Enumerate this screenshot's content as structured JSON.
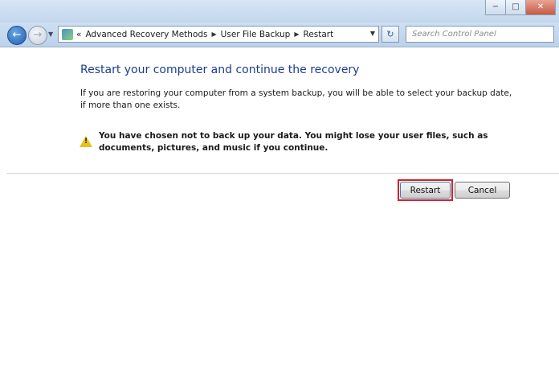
{
  "window": {
    "minimize_glyph": "−",
    "maximize_glyph": "□",
    "close_glyph": "✕"
  },
  "nav": {
    "back_glyph": "←",
    "forward_glyph": "→",
    "dropdown_glyph": "▼",
    "breadcrumb_overflow": "«",
    "crumb_separator": "▶",
    "breadcrumbs": [
      "Advanced Recovery Methods",
      "User File Backup",
      "Restart"
    ],
    "refresh_glyph": "↻",
    "search_placeholder": "Search Control Panel"
  },
  "main": {
    "heading": "Restart your computer and continue the recovery",
    "description": "If you are restoring your computer from a system backup, you will be able to select your backup date, if more than one exists.",
    "warning_glyph": "!",
    "warning": "You have chosen not to back up your data. You might lose your user files, such as documents, pictures, and music if you continue."
  },
  "buttons": {
    "restart": "Restart",
    "cancel": "Cancel"
  },
  "colors": {
    "heading": "#1e3d8f",
    "highlight_outline": "#d6202a"
  },
  "icons": [
    "back-arrow-icon",
    "forward-arrow-icon",
    "control-panel-icon",
    "refresh-icon",
    "warning-icon"
  ]
}
